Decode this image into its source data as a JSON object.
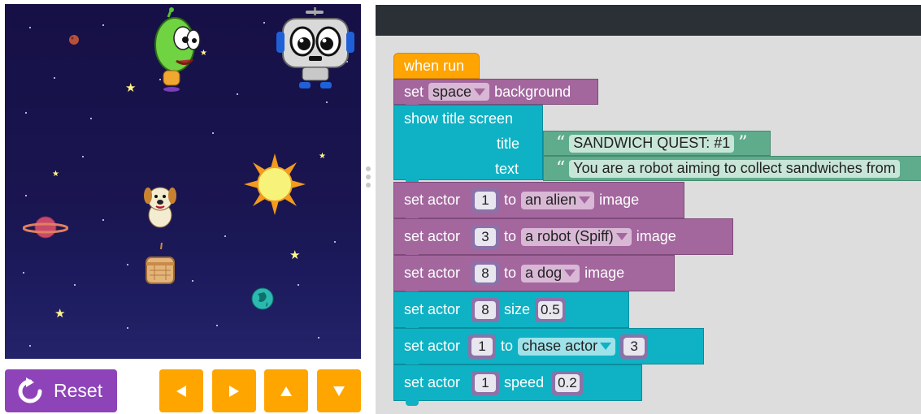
{
  "stage": {
    "sprites": [
      "alien-sprite",
      "robot-sprite",
      "dog-sprite",
      "sandwich-sprite",
      "sun-sprite",
      "planet-sprite",
      "earth-sprite"
    ]
  },
  "controls": {
    "reset_label": "Reset",
    "arrows": [
      "arrow-left-icon",
      "arrow-right-icon",
      "arrow-up-icon",
      "arrow-down-icon"
    ]
  },
  "blocks": {
    "when_run": "when run",
    "set_bg": {
      "label": "set",
      "value": "space",
      "suffix": "background"
    },
    "title_screen": {
      "label": "show title screen",
      "title_label": "title",
      "title_value": "SANDWICH QUEST: #1",
      "text_label": "text",
      "text_value": "You are a robot aiming to collect sandwiches from"
    },
    "actor1": {
      "label": "set actor",
      "num": "1",
      "to": "to",
      "value": "an alien",
      "suffix": "image"
    },
    "actor3": {
      "label": "set actor",
      "num": "3",
      "to": "to",
      "value": "a robot (Spiff)",
      "suffix": "image"
    },
    "actor8": {
      "label": "set actor",
      "num": "8",
      "to": "to",
      "value": "a dog",
      "suffix": "image"
    },
    "size": {
      "label": "set actor",
      "num": "8",
      "mid": "size",
      "value": "0.5"
    },
    "chase": {
      "label": "set actor",
      "num": "1",
      "to": "to",
      "value": "chase actor",
      "target": "3"
    },
    "speed": {
      "label": "set actor",
      "num": "1",
      "mid": "speed",
      "value": "0.2"
    }
  },
  "colors": {
    "motion_block": "#a3679e",
    "control_block": "#0eb2c4",
    "text_block": "#5fac8d",
    "event_block": "#ffa400",
    "reset": "#8e44b8",
    "arrow_button": "#ffa500"
  }
}
